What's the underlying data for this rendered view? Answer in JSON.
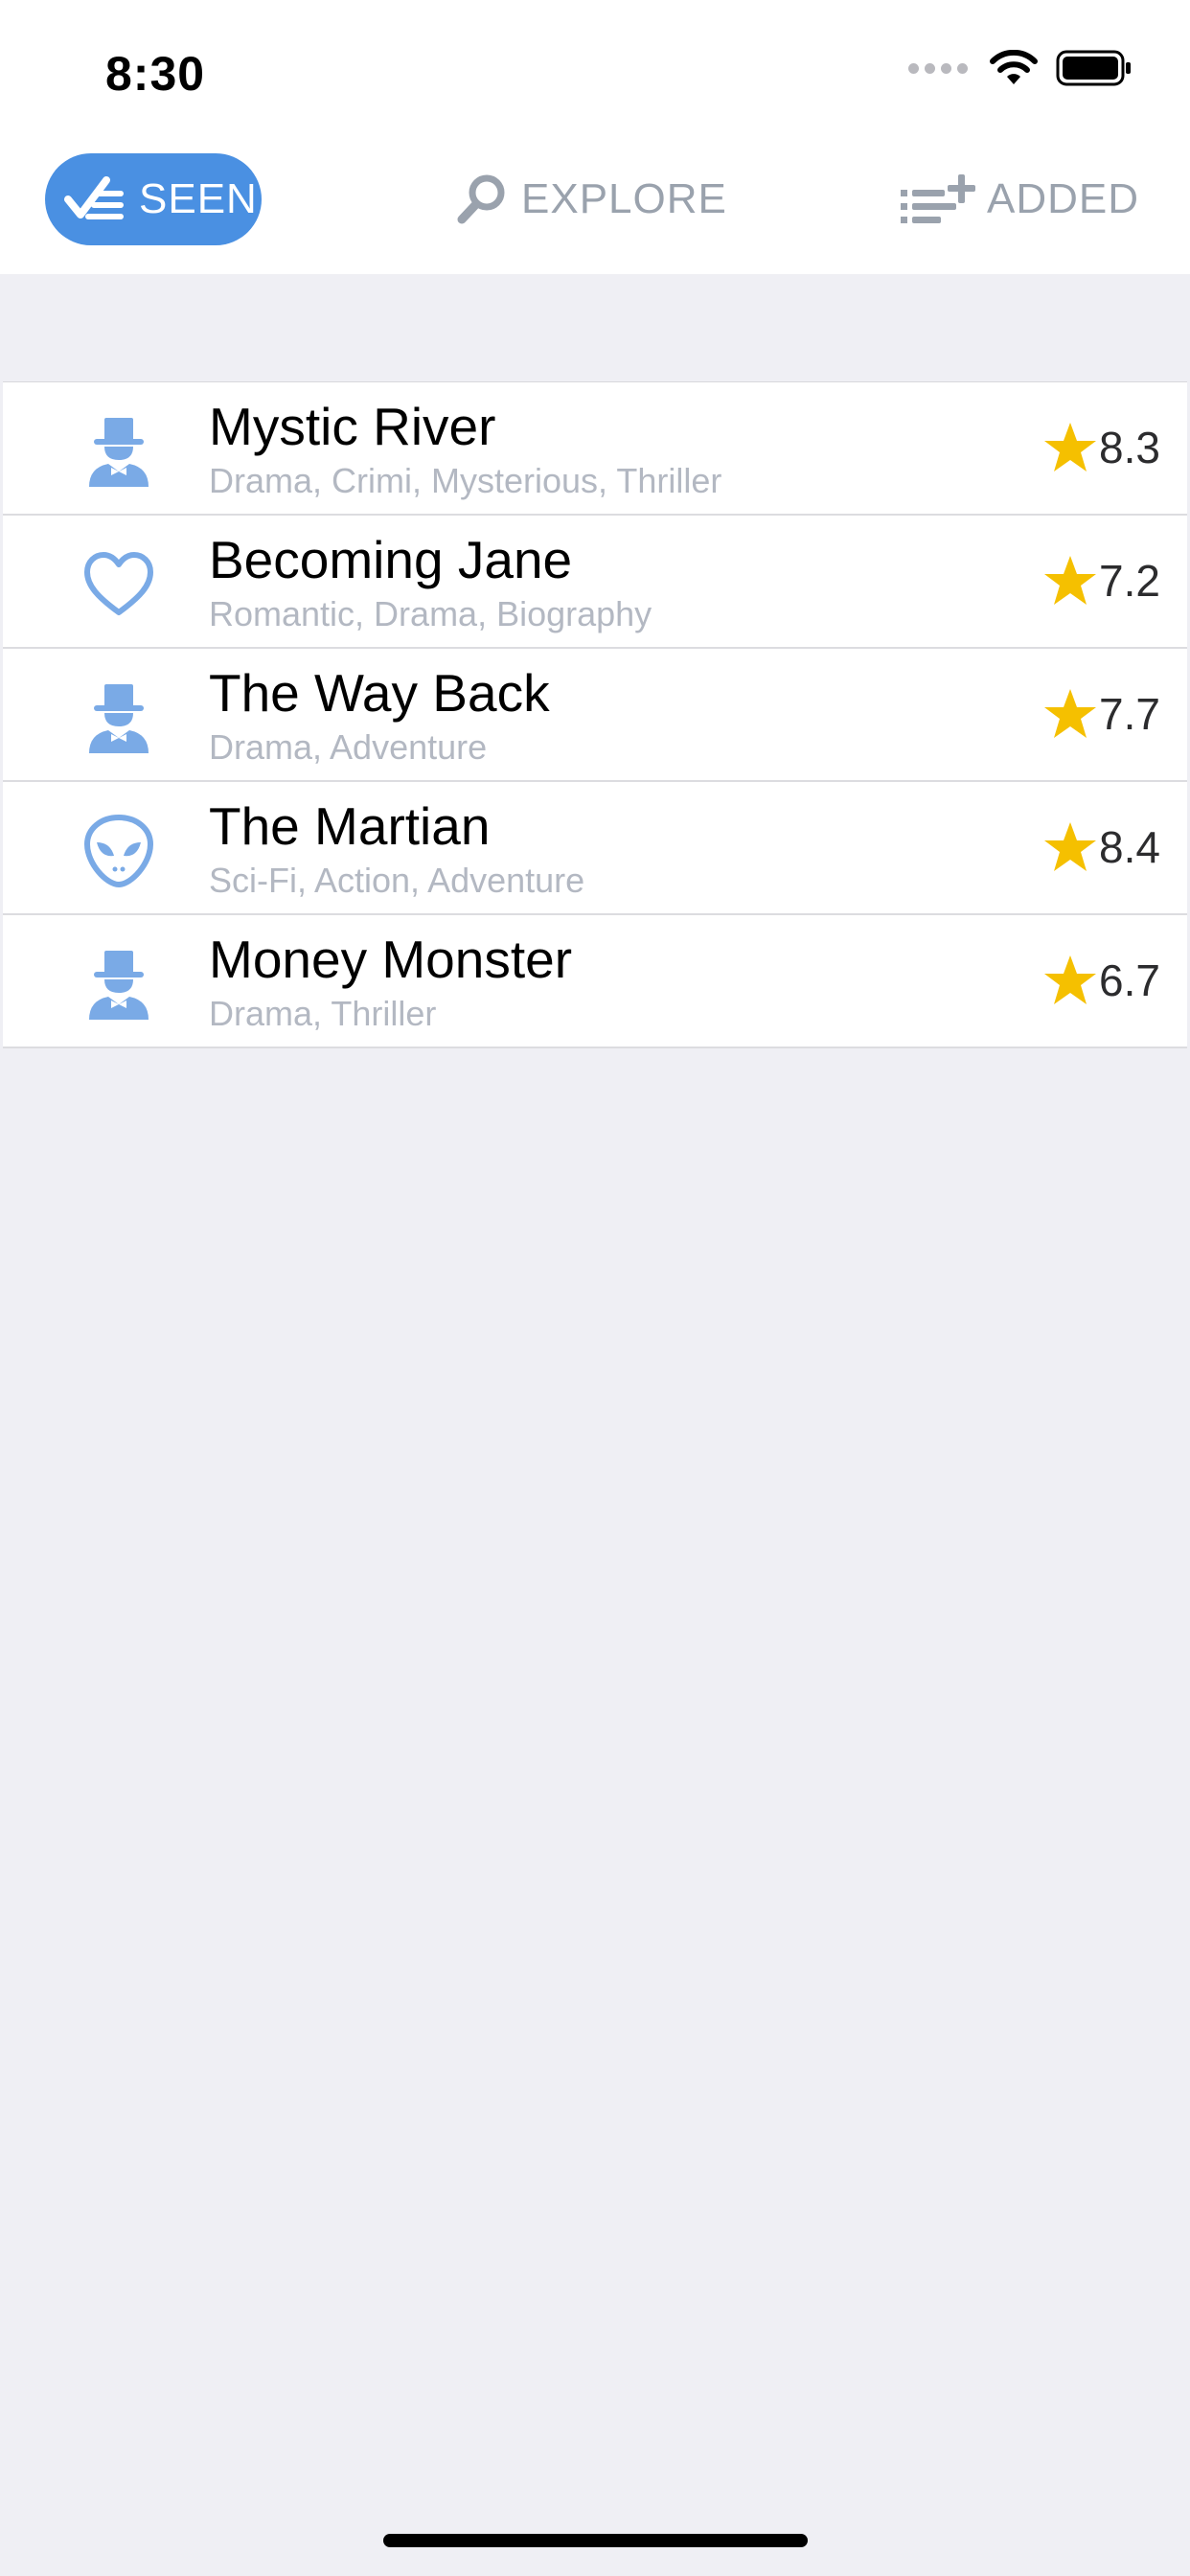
{
  "status_bar": {
    "time": "8:30"
  },
  "tabs": [
    {
      "label": "SEEN",
      "icon": "checklist-icon",
      "active": true
    },
    {
      "label": "EXPLORE",
      "icon": "search-icon",
      "active": false
    },
    {
      "label": "ADDED",
      "icon": "add-list-icon",
      "active": false
    }
  ],
  "movies": [
    {
      "title": "Mystic River",
      "genres": "Drama, Crimi, Mysterious, Thriller",
      "rating": "8.3",
      "icon": "gentleman-icon"
    },
    {
      "title": "Becoming Jane",
      "genres": "Romantic, Drama, Biography",
      "rating": "7.2",
      "icon": "heart-icon"
    },
    {
      "title": "The Way Back",
      "genres": "Drama, Adventure",
      "rating": "7.7",
      "icon": "gentleman-icon"
    },
    {
      "title": "The Martian",
      "genres": "Sci-Fi, Action, Adventure",
      "rating": "8.4",
      "icon": "alien-icon"
    },
    {
      "title": "Money Monster",
      "genres": "Drama, Thriller",
      "rating": "6.7",
      "icon": "gentleman-icon"
    }
  ],
  "colors": {
    "accent": "#4a90e2",
    "icon": "#7aaae6",
    "star": "#f5c000",
    "inactive_tab": "#9aa2ad",
    "genre_text": "#b3b8c2",
    "background": "#efeff4"
  }
}
